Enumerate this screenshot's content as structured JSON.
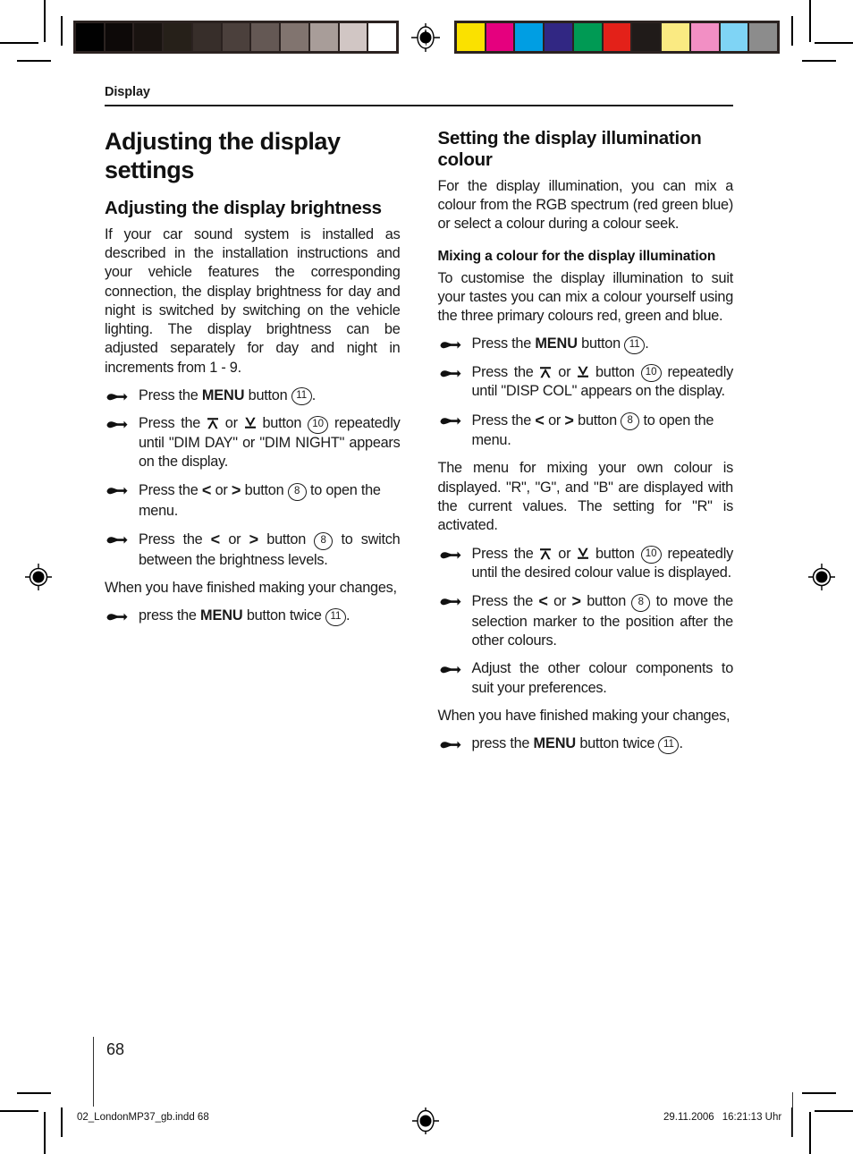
{
  "page": {
    "running_head": "Display",
    "folio": "68",
    "footer_file": "02_LondonMP37_gb.indd   68",
    "footer_date": "29.11.2006",
    "footer_time": "16:21:13 Uhr",
    "footer_time_unit": "Uhr"
  },
  "calibration": {
    "gray_bar": {
      "name": "grayscale-calibration-bar",
      "frame_color": "#2b2220",
      "swatches": [
        "#010101",
        "#0d0908",
        "#191310",
        "#262019",
        "#372e2a",
        "#4b403c",
        "#645854",
        "#81746f",
        "#a89d99",
        "#d1c6c4",
        "#ffffff"
      ]
    },
    "color_bar": {
      "name": "colour-calibration-bar",
      "frame_color": "#2b2220",
      "swatches": [
        "#fae100",
        "#e5007e",
        "#009ee3",
        "#312783",
        "#009a54",
        "#e32119",
        "#201b19",
        "#faea82",
        "#f28fc4",
        "#7fd4f5",
        "#8c8c8c"
      ]
    }
  },
  "content": {
    "chapter_title": "Adjusting the display settings",
    "left_column": {
      "section_title": "Adjusting the display brightness",
      "intro": "If your car sound system is installed as described in the installation instructions and your vehicle features the corresponding connection, the display brightness for day and night is switched by switching on the vehicle lighting. The display brightness can be adjusted separately for day and night in increments from 1 - 9.",
      "steps": [
        {
          "before": "Press the ",
          "bold": "MENU",
          "after": " button ",
          "keynum": "11",
          "tail": "."
        },
        {
          "before": "Press the ",
          "arrow_up": "up-arrow-bar-icon",
          "mid": " or ",
          "arrow_down": "down-arrow-bar-icon",
          "after": " button ",
          "keynum": "10",
          "tail": " repeatedly until \"DIM DAY\" or \"DIM NIGHT\" appears on the display."
        },
        {
          "before": "Press the ",
          "chev_left": "<",
          "mid": " or ",
          "chev_right": ">",
          "after": " button ",
          "keynum": "8",
          "tail": " to open the menu."
        },
        {
          "before": "Press the ",
          "chev_left": "<",
          "mid": " or ",
          "chev_right": ">",
          "after": " button ",
          "keynum": "8",
          "tail": " to switch between the brightness levels."
        }
      ],
      "closing_text": "When you have finished making your changes,",
      "closing_step": {
        "before": "press the ",
        "bold": "MENU",
        "after": " button twice ",
        "keynum": "11",
        "tail": "."
      }
    },
    "right_column": {
      "section_title": "Setting the display illumination colour",
      "intro": "For the display illumination, you can mix a colour from the RGB spectrum (red green blue) or select a colour during a colour seek.",
      "sub_title": "Mixing a colour for the display illumination",
      "sub_intro": "To customise the display illumination to suit your tastes you can mix a colour yourself using the three primary colours red, green and blue.",
      "steps_a": [
        {
          "before": "Press the ",
          "bold": "MENU",
          "after": " button ",
          "keynum": "11",
          "tail": "."
        },
        {
          "before": "Press the ",
          "arrow_up": "up-arrow-bar-icon",
          "mid": " or ",
          "arrow_down": "down-arrow-bar-icon",
          "after": " button ",
          "keynum": "10",
          "tail": " repeatedly until \"DISP COL\" appears on the display."
        },
        {
          "before": "Press the ",
          "chev_left": "<",
          "mid": " or ",
          "chev_right": ">",
          "after": " button ",
          "keynum": "8",
          "tail": " to open the menu."
        }
      ],
      "mid_text": "The menu for mixing your own colour is displayed. \"R\", \"G\", and \"B\" are displayed with the current values. The setting for \"R\" is activated.",
      "steps_b": [
        {
          "before": "Press the ",
          "arrow_up": "up-arrow-bar-icon",
          "mid": " or ",
          "arrow_down": "down-arrow-bar-icon",
          "after": " button ",
          "keynum": "10",
          "tail": " repeatedly until the desired colour value is displayed."
        },
        {
          "before": "Press the ",
          "chev_left": "<",
          "mid": " or ",
          "chev_right": ">",
          "after": " button ",
          "keynum": "8",
          "tail": " to move the selection marker to the position after the other colours."
        },
        {
          "plain": "Adjust the other colour components to suit your preferences."
        }
      ],
      "closing_text": "When you have finished making your changes,",
      "closing_step": {
        "before": "press the ",
        "bold": "MENU",
        "after": " button twice ",
        "keynum": "11",
        "tail": "."
      }
    }
  }
}
